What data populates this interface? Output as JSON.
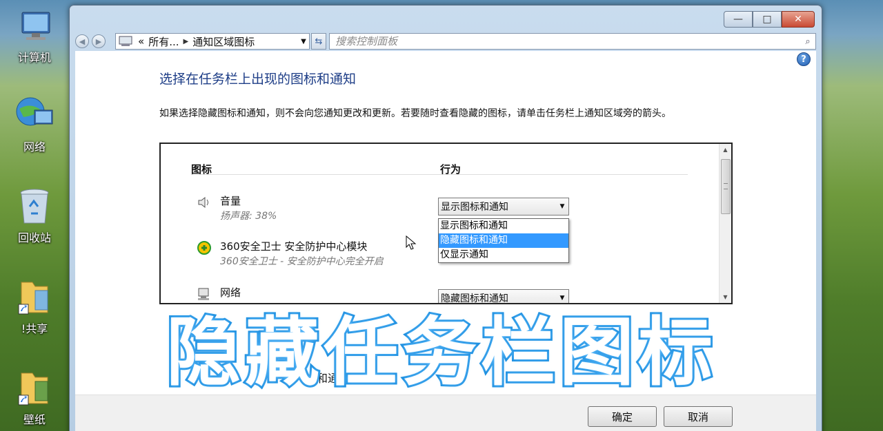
{
  "desktop": {
    "icons": [
      {
        "label": "计算机"
      },
      {
        "label": "网络"
      },
      {
        "label": "回收站"
      },
      {
        "label": "!共享"
      },
      {
        "label": "壁纸"
      }
    ]
  },
  "window": {
    "caption": {
      "minimize": "—",
      "maximize": "□",
      "close": "✕"
    },
    "address": {
      "part1": "所有...",
      "part2": "通知区域图标",
      "prefix": "«"
    },
    "search": {
      "placeholder": "搜索控制面板"
    },
    "title": "选择在任务栏上出现的图标和通知",
    "description": "如果选择隐藏图标和通知，则不会向您通知更改和更新。若要随时查看隐藏的图标，请单击任务栏上通知区域旁的箭头。",
    "columns": {
      "icon": "图标",
      "behavior": "行为"
    },
    "rows": [
      {
        "name": "音量",
        "sub": "扬声器: 38%",
        "behavior": "显示图标和通知"
      },
      {
        "name": "360安全卫士 安全防护中心模块",
        "sub": "360安全卫士 - 安全防护中心完全开启",
        "behavior": ""
      },
      {
        "name": "网络",
        "sub": "",
        "behavior": "隐藏图标和通知"
      }
    ],
    "dropdown_options": [
      "显示图标和通知",
      "隐藏图标和通知",
      "仅显示通知"
    ],
    "dropdown_highlighted": "隐藏图标和通知",
    "partial_text": "和通知",
    "buttons": {
      "ok": "确定",
      "cancel": "取消"
    }
  },
  "overlay": {
    "text": "隐藏任务栏图标",
    "color": "#1d8fe0"
  }
}
